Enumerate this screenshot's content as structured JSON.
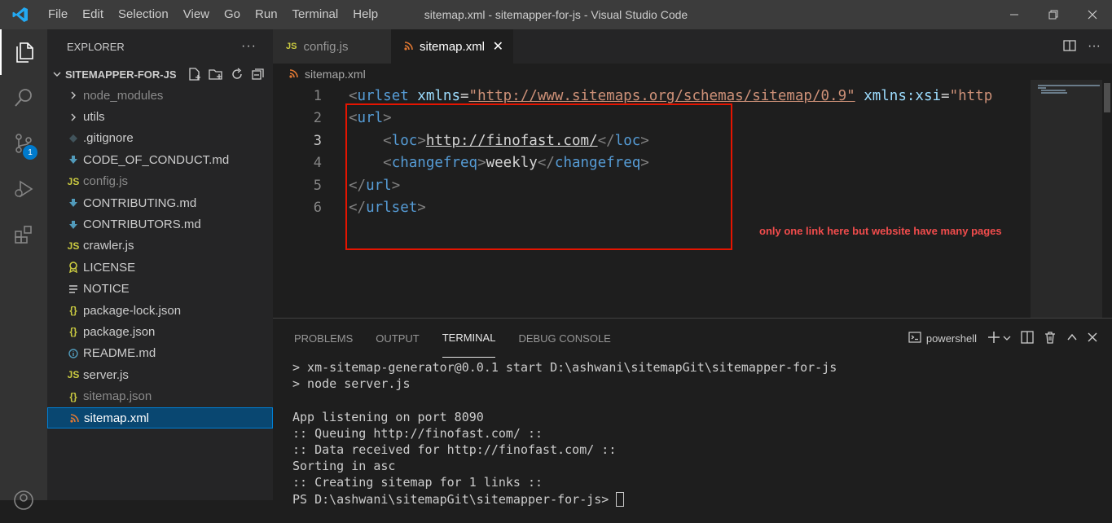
{
  "titlebar": {
    "menu": [
      "File",
      "Edit",
      "Selection",
      "View",
      "Go",
      "Run",
      "Terminal",
      "Help"
    ],
    "title": "sitemap.xml - sitemapper-for-js - Visual Studio Code"
  },
  "activity": {
    "scm_badge": "1"
  },
  "sidebar": {
    "header": "EXPLORER",
    "more": "···",
    "folder": "SITEMAPPER-FOR-JS",
    "items": [
      {
        "label": "node_modules",
        "icon": "chevron-right"
      },
      {
        "label": "utils",
        "icon": "chevron-right"
      },
      {
        "label": ".gitignore",
        "icon": "diamond"
      },
      {
        "label": "CODE_OF_CONDUCT.md",
        "icon": "markdown"
      },
      {
        "label": "config.js",
        "icon": "js"
      },
      {
        "label": "CONTRIBUTING.md",
        "icon": "markdown"
      },
      {
        "label": "CONTRIBUTORS.md",
        "icon": "markdown"
      },
      {
        "label": "crawler.js",
        "icon": "js"
      },
      {
        "label": "LICENSE",
        "icon": "license"
      },
      {
        "label": "NOTICE",
        "icon": "lines"
      },
      {
        "label": "package-lock.json",
        "icon": "json"
      },
      {
        "label": "package.json",
        "icon": "json"
      },
      {
        "label": "README.md",
        "icon": "info"
      },
      {
        "label": "server.js",
        "icon": "js"
      },
      {
        "label": "sitemap.json",
        "icon": "json"
      },
      {
        "label": "sitemap.xml",
        "icon": "rss"
      }
    ]
  },
  "tabs": [
    {
      "label": "config.js",
      "icon_text": "JS"
    },
    {
      "label": "sitemap.xml",
      "close": "✕"
    }
  ],
  "breadcrumb": "sitemap.xml",
  "editor": {
    "line_numbers": [
      "1",
      "2",
      "3",
      "4",
      "5",
      "6"
    ],
    "line1": {
      "lt": "<",
      "tag": "urlset",
      "attr1": " xmlns",
      "eq1": "=",
      "val1": "\"http://www.sitemaps.org/schemas/sitemap/0.9\"",
      "attr2": " xmlns:xsi",
      "eq2": "=",
      "val2": "\"http"
    },
    "line2": {
      "lt": "<",
      "tag": "url",
      "gt": ">"
    },
    "line3": {
      "indent": "    ",
      "lt": "<",
      "tag": "loc",
      "gt": ">",
      "link": "http://finofast.com/",
      "lt2": "</",
      "tag2": "loc",
      "gt2": ">"
    },
    "line4": {
      "indent": "    ",
      "lt": "<",
      "tag": "changefreq",
      "gt": ">",
      "text": "weekly",
      "lt2": "</",
      "tag2": "changefreq",
      "gt2": ">"
    },
    "line5": {
      "lt": "</",
      "tag": "url",
      "gt": ">"
    },
    "line6": {
      "lt": "</",
      "tag": "urlset",
      "gt": ">"
    },
    "annotation": "only one link here but website have many pages"
  },
  "panel": {
    "tabs": [
      "PROBLEMS",
      "OUTPUT",
      "TERMINAL",
      "DEBUG CONSOLE"
    ],
    "shell": "powershell",
    "terminal_lines": [
      "> xm-sitemap-generator@0.0.1 start D:\\ashwani\\sitemapGit\\sitemapper-for-js",
      "> node server.js",
      "",
      "App listening on port 8090",
      ":: Queuing http://finofast.com/ ::",
      ":: Data received for http://finofast.com/ ::",
      "Sorting in asc",
      ":: Creating sitemap for 1 links ::",
      "PS D:\\ashwani\\sitemapGit\\sitemapper-for-js> "
    ]
  }
}
